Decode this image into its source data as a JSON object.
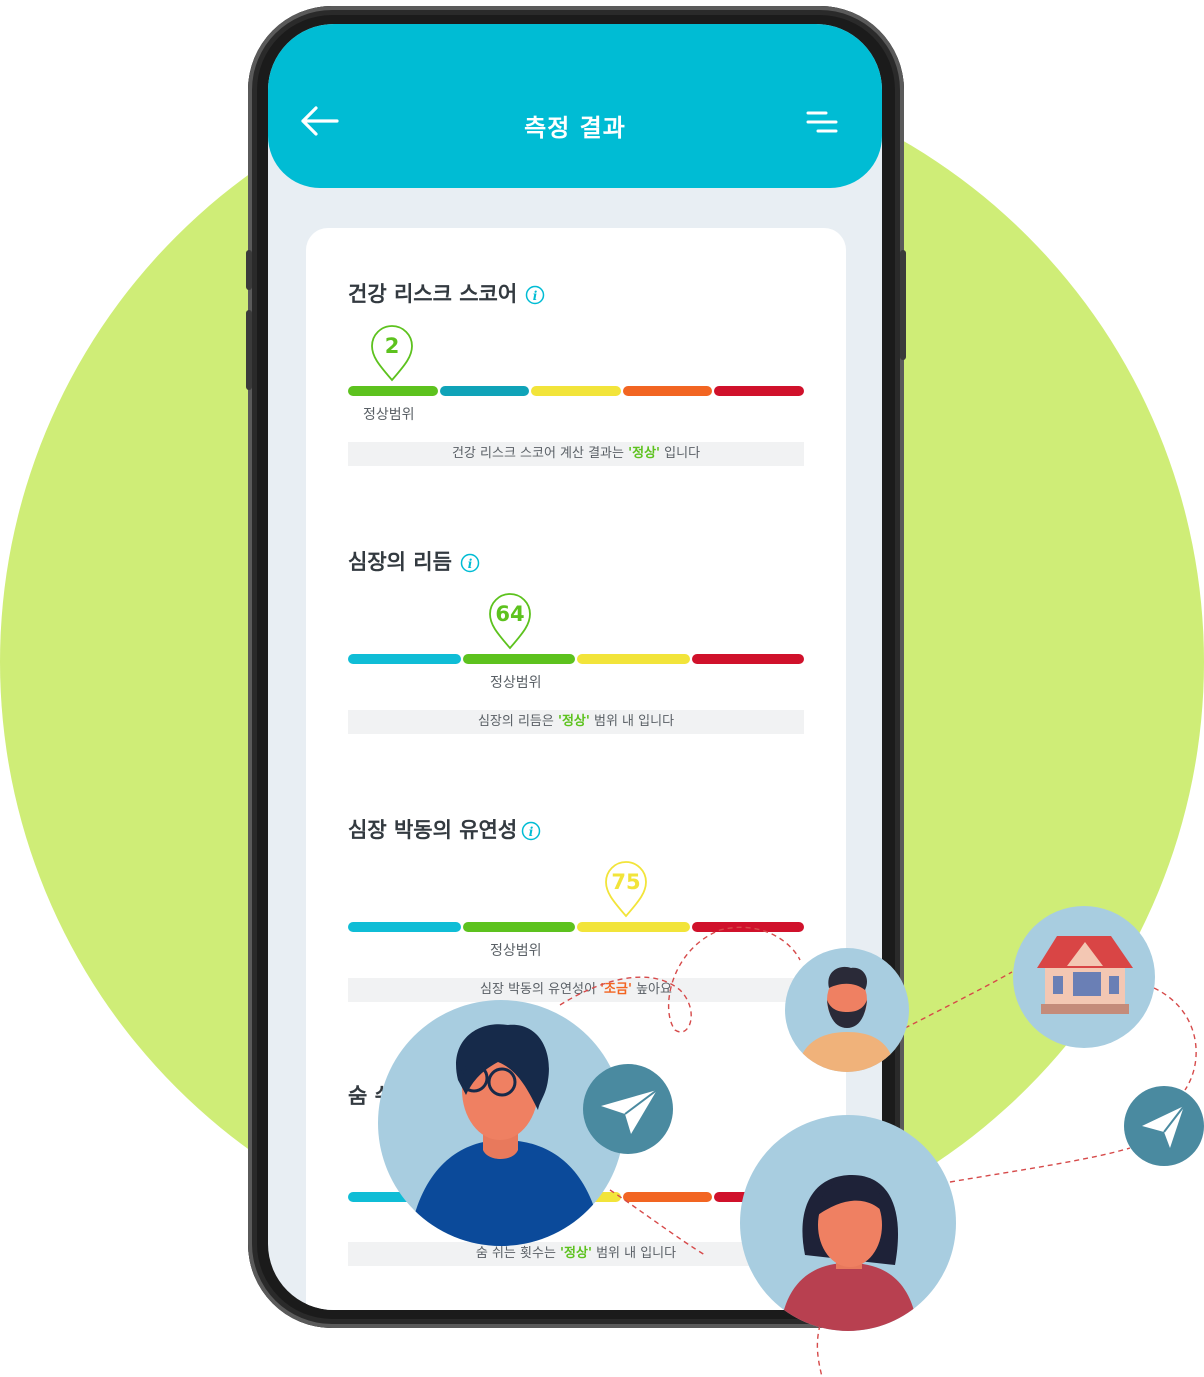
{
  "header": {
    "title": "측정 결과",
    "back_icon": "arrow-left-icon",
    "menu_icon": "menu-lines-icon",
    "color": "#00bcd4"
  },
  "sections": [
    {
      "title": "건강 리스크 스코어",
      "value": "2",
      "value_color": "#5dc21e",
      "segments": [
        "#5dc21e",
        "#0fa3b8",
        "#f2e43a",
        "#f26522",
        "#d0112b"
      ],
      "active_segment": 0,
      "range_label": "정상범위",
      "note_prefix": "건강 리스크 스코어 계산 결과는 ",
      "note_highlight": "'정상'",
      "note_highlight_color": "#5dc21e",
      "note_suffix": " 입니다"
    },
    {
      "title": "심장의 리듬",
      "value": "64",
      "value_color": "#5dc21e",
      "segments": [
        "#0fbdd6",
        "#5dc21e",
        "#f2e43a",
        "#d0112b"
      ],
      "active_segment": 1,
      "range_label": "정상범위",
      "note_prefix": "심장의 리듬은 ",
      "note_highlight": "'정상'",
      "note_highlight_color": "#5dc21e",
      "note_suffix": " 범위 내 입니다"
    },
    {
      "title": "심장 박동의 유연성",
      "value": "75",
      "value_color": "#f2e43a",
      "segments": [
        "#0fbdd6",
        "#5dc21e",
        "#f2e43a",
        "#d0112b"
      ],
      "active_segment": 2,
      "range_label": "정상범위",
      "note_prefix": "심장 박동의 유연성이 ",
      "note_highlight": "'조금'",
      "note_highlight_color": "#f26522",
      "note_suffix": " 높아요"
    },
    {
      "title": "숨 쉬",
      "segments": [
        "#0fbdd6",
        "#5dc21e",
        "#f2e43a",
        "#f26522",
        "#d0112b"
      ],
      "note_prefix": "숨 쉬는 횟수는 ",
      "note_highlight": "'정상'",
      "note_highlight_color": "#5dc21e",
      "note_suffix": " 범위 내 입니다"
    }
  ],
  "colors": {
    "background_circle": "#cfed77",
    "avatar_bg": "#a8cde0",
    "send_button": "#4a8aa0"
  }
}
